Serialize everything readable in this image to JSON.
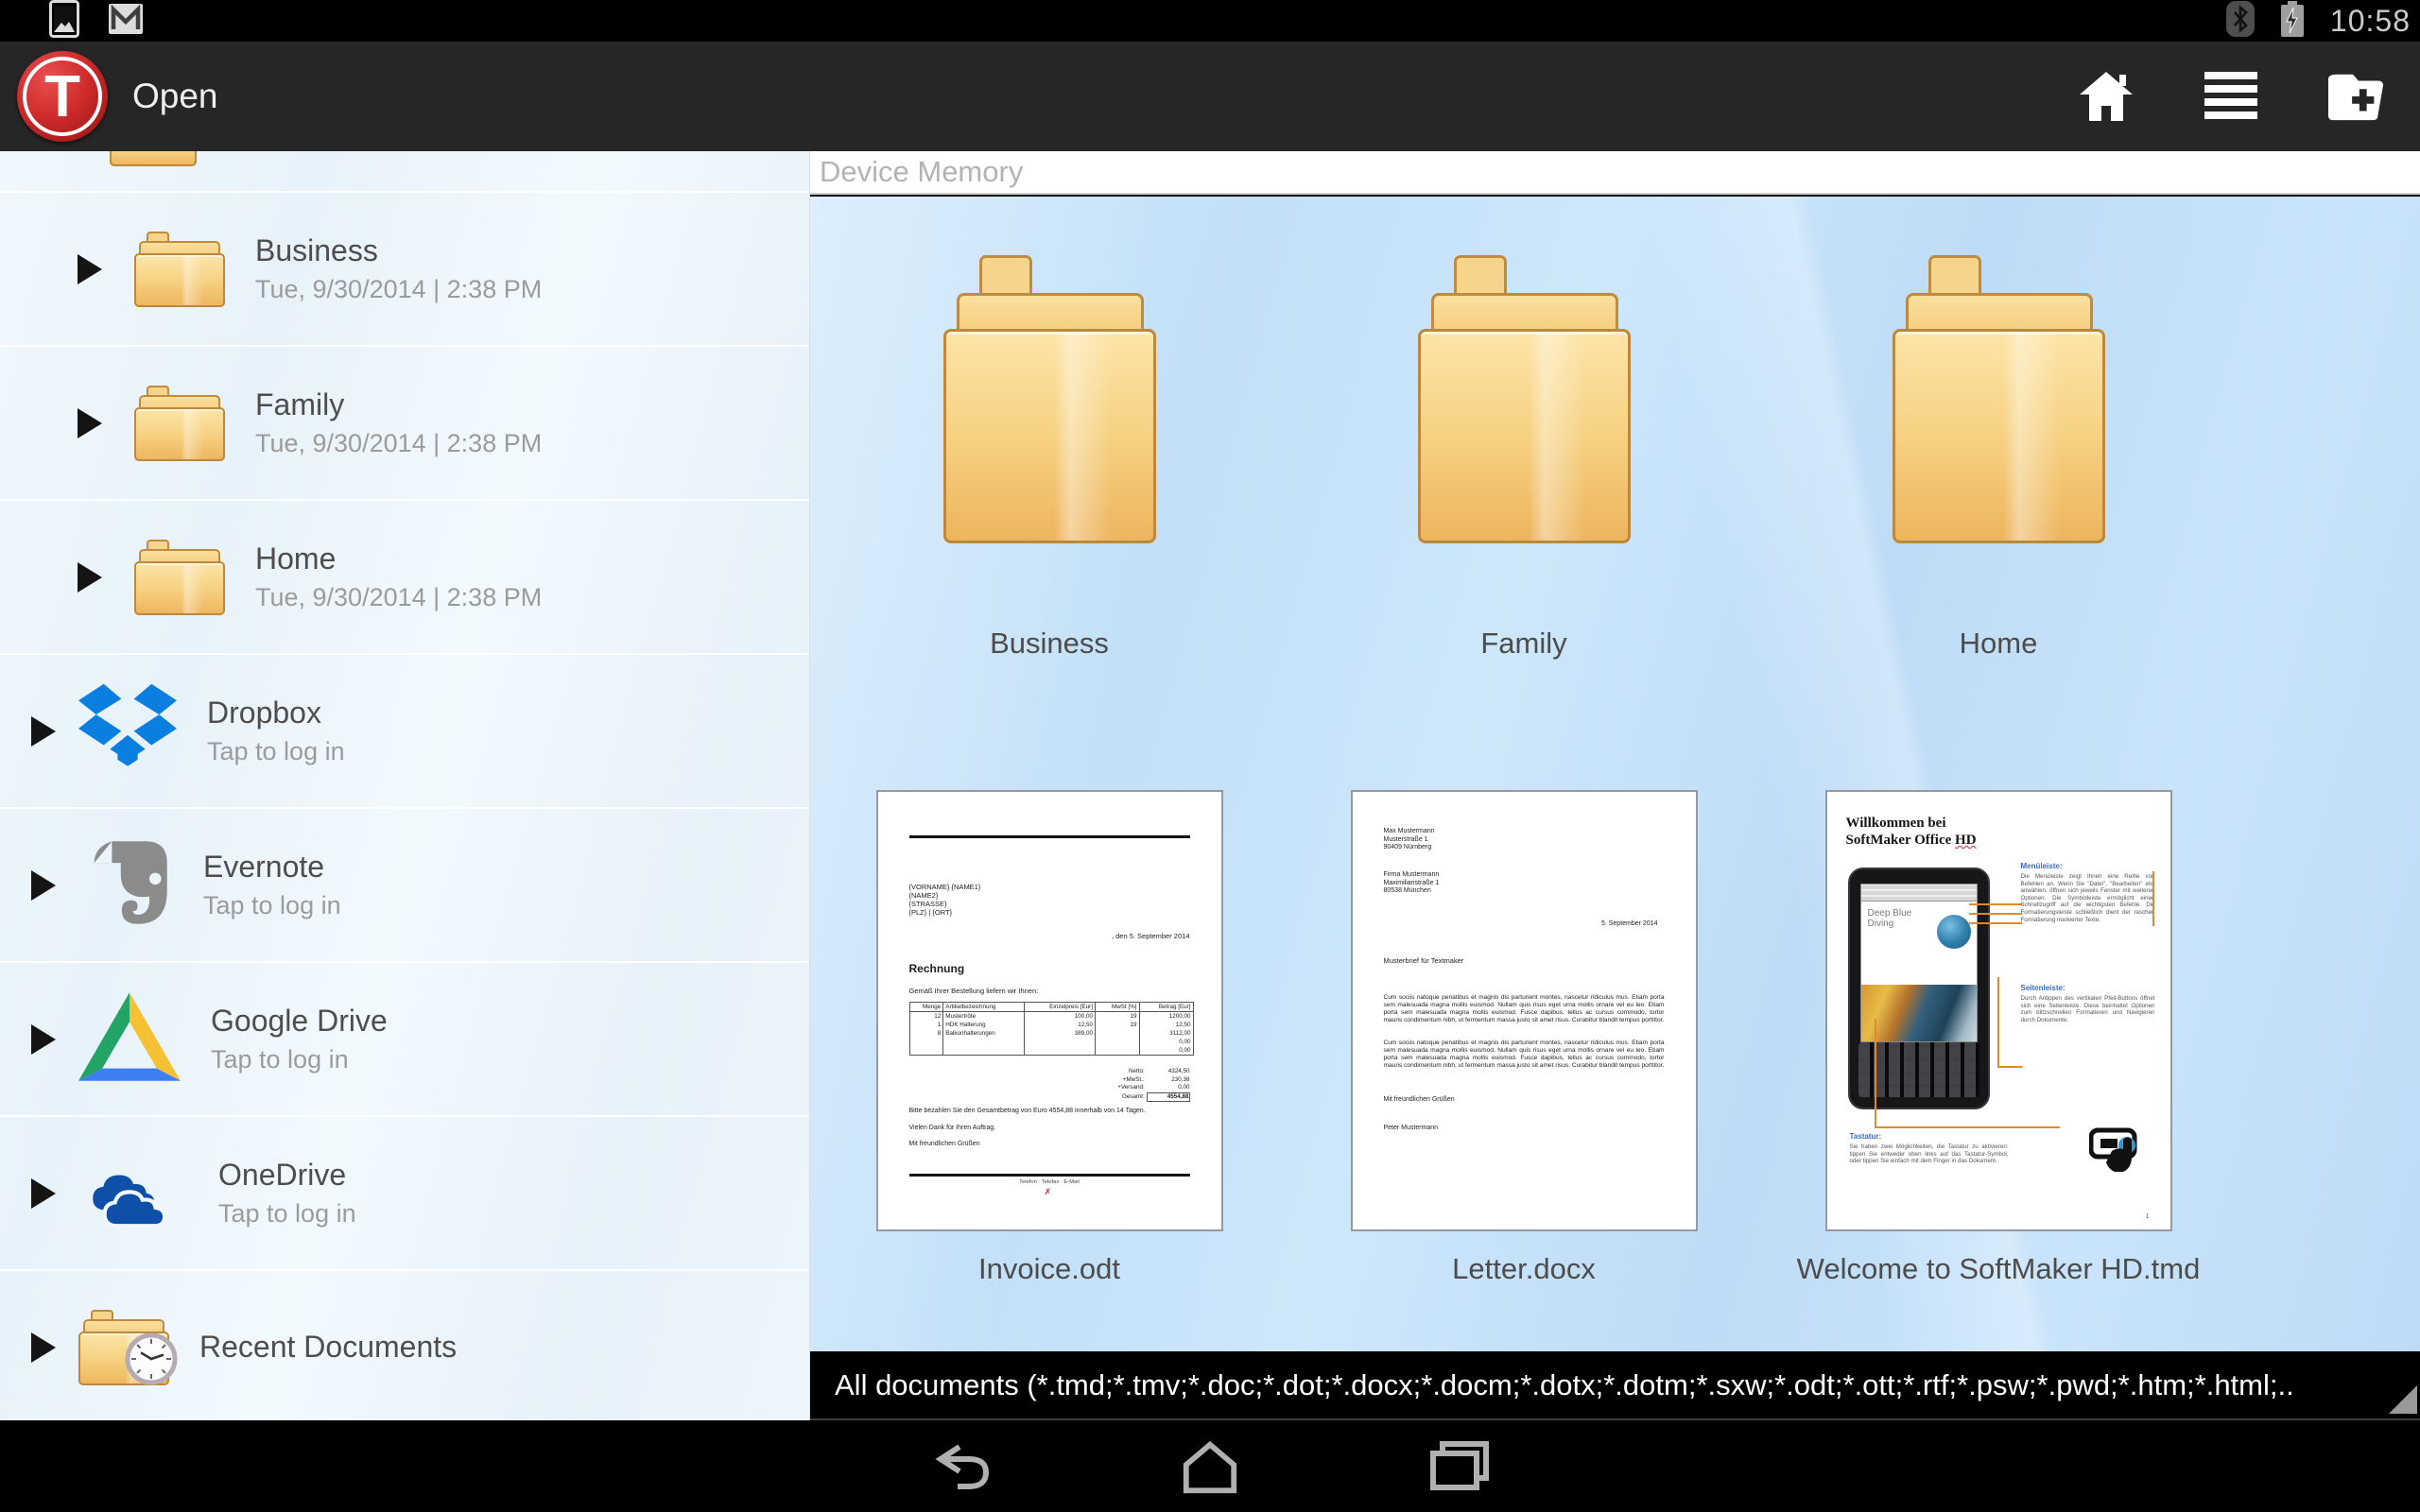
{
  "status_bar": {
    "time": "10:58",
    "left_icons": [
      "screenshot",
      "gmail"
    ],
    "right_icons": [
      "bluetooth",
      "battery-charging"
    ]
  },
  "app_bar": {
    "logo_letter": "T",
    "title": "Open",
    "actions": [
      "home",
      "file-list",
      "new-folder"
    ]
  },
  "sidebar": {
    "items": [
      {
        "title": "Business",
        "subtitle": "Tue, 9/30/2014 | 2:38 PM",
        "icon": "folder"
      },
      {
        "title": "Family",
        "subtitle": "Tue, 9/30/2014 | 2:38 PM",
        "icon": "folder"
      },
      {
        "title": "Home",
        "subtitle": "Tue, 9/30/2014 | 2:38 PM",
        "icon": "folder"
      },
      {
        "title": "Dropbox",
        "subtitle": "Tap to log in",
        "icon": "dropbox"
      },
      {
        "title": "Evernote",
        "subtitle": "Tap to log in",
        "icon": "evernote"
      },
      {
        "title": "Google Drive",
        "subtitle": "Tap to log in",
        "icon": "google-drive"
      },
      {
        "title": "OneDrive",
        "subtitle": "Tap to log in",
        "icon": "onedrive"
      },
      {
        "title": "Recent Documents",
        "subtitle": "",
        "icon": "recent-folder"
      }
    ]
  },
  "main": {
    "header": "Device Memory",
    "folders": [
      {
        "label": "Business"
      },
      {
        "label": "Family"
      },
      {
        "label": "Home"
      }
    ],
    "documents": [
      {
        "label": "Invoice.odt"
      },
      {
        "label": "Letter.docx"
      },
      {
        "label": "Welcome to SoftMaker HD.tmd"
      }
    ],
    "filter_bar": "All documents (*.tmd;*.tmv;*.doc;*.dot;*.docx;*.docm;*.dotx;*.dotm;*.sxw;*.odt;*.ott;*.rtf;*.psw;*.pwd;*.htm;*.html;.."
  },
  "docs": {
    "invoice": {
      "address_lines": [
        "{VORNAME} {NAME1}",
        "{NAME2}",
        "{STRASSE}",
        "{PLZ} | {ORT}"
      ],
      "date_line": ", den 5. September 2014",
      "heading": "Rechnung",
      "intro": "Gemäß Ihrer Bestellung liefern wir Ihnen:",
      "table": {
        "headers": [
          "Menge",
          "Artikelbezeichnung",
          "Einzelpreis [Eur]",
          "MwSt [%]",
          "Betrag [Eur]"
        ],
        "rows": [
          [
            "12",
            "Mustertröte",
            "100,00",
            "19",
            "1200,00"
          ],
          [
            "1",
            "HDK Halterung",
            "12,50",
            "19",
            "12,50"
          ],
          [
            "8",
            "Balkonhalterungen",
            "389,00",
            "",
            "3112,00"
          ],
          [
            "",
            "",
            "",
            "",
            "0,00"
          ],
          [
            "",
            "",
            "",
            "",
            "0,00"
          ]
        ],
        "totals": [
          {
            "label": "Netto:",
            "value": "4324,50"
          },
          {
            "label": "+MwSt.:",
            "value": "230,38"
          },
          {
            "label": "+Versand:",
            "value": "0,00"
          },
          {
            "label": "Gesamt:",
            "value": "4554,88"
          }
        ]
      },
      "note": "Bitte bezahlen Sie den Gesamtbetrag von Euro 4554,88 innerhalb von 14 Tagen.",
      "thanks": "Vielen Dank für Ihren Auftrag.",
      "closing": "Mit freundlichen Grüßen",
      "footer": "Telefon  ·  Telefax  ·  E-Mail",
      "footer_mark": "✗"
    },
    "letter": {
      "sender_lines": [
        "Max Mustermann",
        "Musterstraße 1",
        "90409 Nürnberg"
      ],
      "recipient_lines": [
        "Firma Mustermann",
        "Maximilianstraße 1",
        "80538 München"
      ],
      "date_line": "5. September 2014",
      "subject": "Musterbrief für Textmaker",
      "body_paragraph": "Cum sociis natoque penatibus et magnis dis parturient montes, nascetur ridiculus mus. Etiam porta sem malesuada magna mollis euismod. Nullam quis risus eget urna mollis ornare vel eu leo. Etiam porta sem malesuada magna mollis euismod. Fusce dapibus, tellus ac cursus commodo, tortor mauris condimentum nibh, ut fermentum massa justo sit amet risus. Curabitur blandit tempus porttitor.",
      "closing": "Mit freundlichen Grüßen",
      "signature": "Peter Mustermann"
    },
    "welcome": {
      "title_line1": "Willkommen bei",
      "title_line2": "SoftMaker Office ",
      "title_hd": "HD",
      "screen_title": "Deep Blue Diving",
      "sections": [
        {
          "heading": "Menüleiste:",
          "body": "Die Menüleiste zeigt Ihnen eine Reihe von Befehlen an. Wenn Sie \"Datei\", \"Bearbeiten\" etc. anwählen, öffnen sich jeweils Fenster mit weiteren Optionen. Die Symbolleiste ermöglicht einen Schnellzugriff auf die wichtigsten Befehle. Die Formatierungsleiste schließlich dient der raschen Formatierung markierter Texte."
        },
        {
          "heading": "Seitenleiste:",
          "body": "Durch Antippen des vertikalen Pfeil-Buttons öffnet sich eine Seitenleiste. Diese beinhaltet Optionen zum blitzschnellen Formatieren und Navigieren durch Dokumente."
        },
        {
          "heading": "Tastatur:",
          "body": "Sie haben zwei Möglichkeiten, die Tastatur zu aktivieren: tippen Sie entweder oben links auf das Tastatur-Symbol, oder tippen Sie einfach mit dem Finger in das Dokument."
        }
      ],
      "page_number": "1"
    }
  },
  "nav_bar": {
    "buttons": [
      "back",
      "home",
      "recents"
    ]
  },
  "colors": {
    "app_bar": "#262626",
    "folder_tan": "#f6d283",
    "folder_border": "#bd883b",
    "dropbox_blue": "#0b7fe0",
    "evernote_gray": "#8b8b8b",
    "drive_green": "#21a464",
    "drive_yellow": "#f5c033",
    "drive_blue": "#3d7ef2",
    "onedrive_blue": "#0e4fa8",
    "main_bg_blue": "#c5e2f9"
  }
}
